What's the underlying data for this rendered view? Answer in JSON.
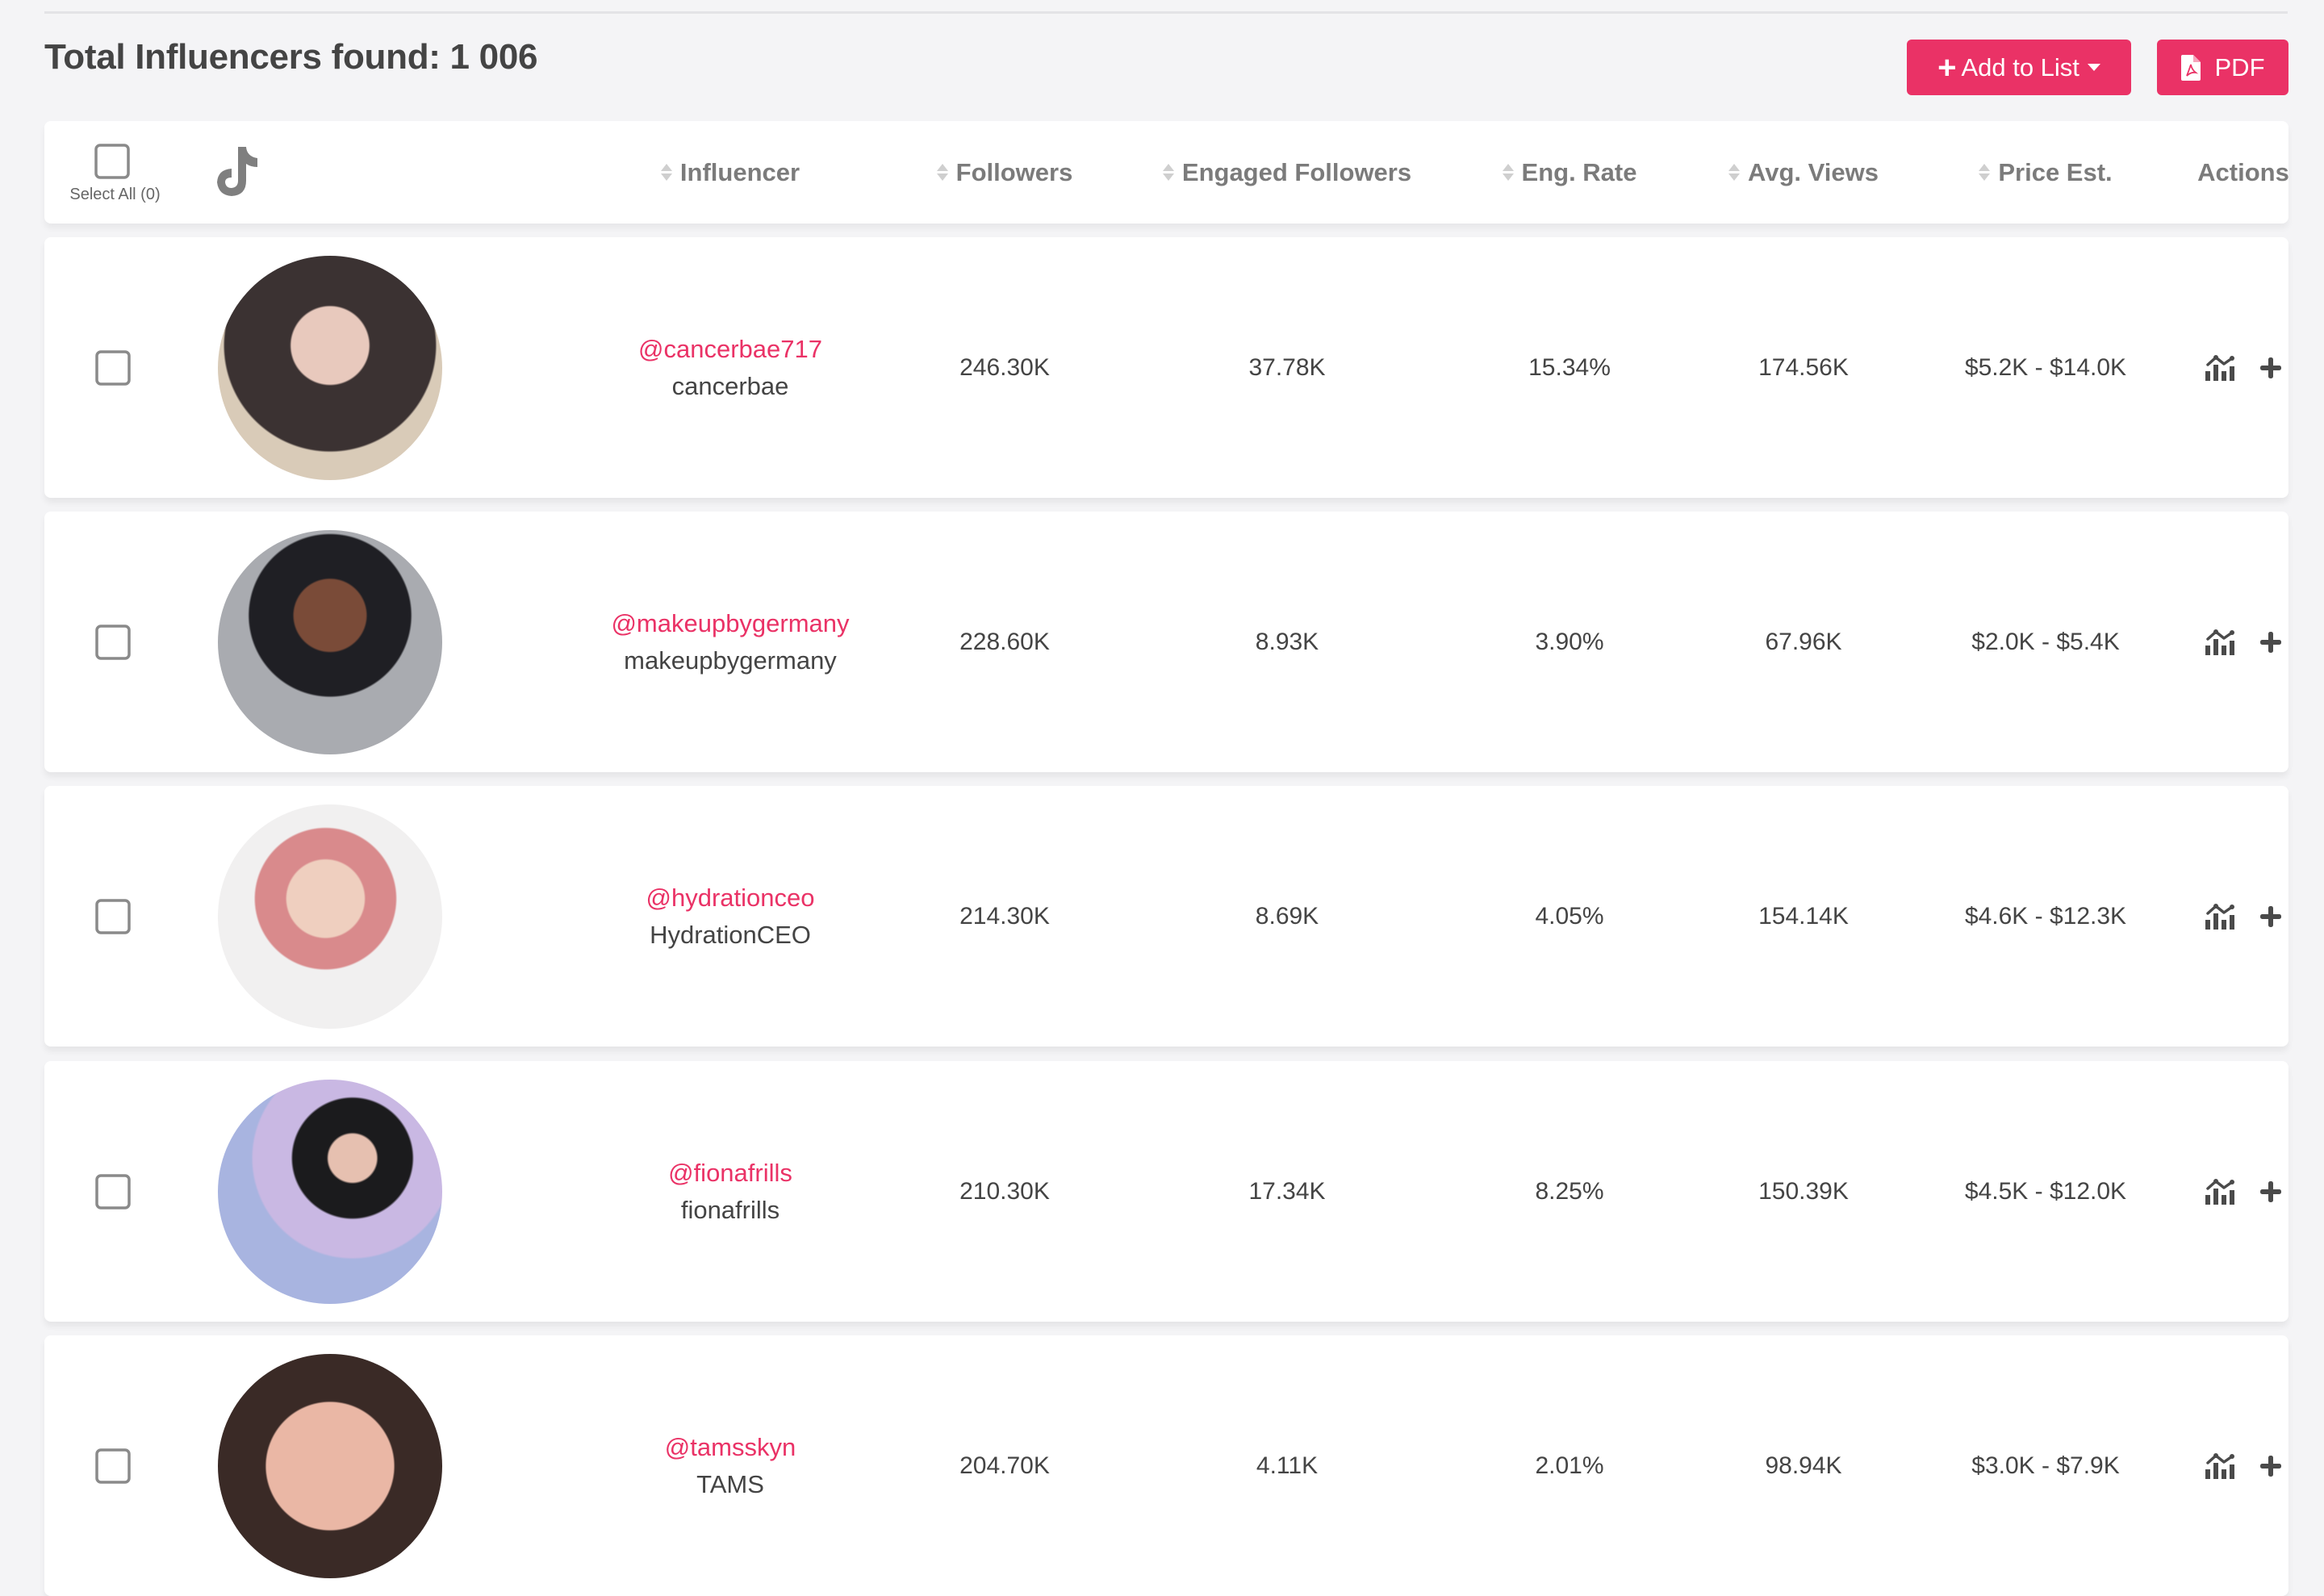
{
  "header": {
    "title": "Total Influencers found: 1 006",
    "add_to_list_label": "Add to List",
    "pdf_label": "PDF",
    "accent_color": "#ea3266"
  },
  "table": {
    "select_all_label": "Select All (0)",
    "platform_icon": "tiktok-icon",
    "columns": [
      {
        "label": "Influencer",
        "sortable": true
      },
      {
        "label": "Followers",
        "sortable": true
      },
      {
        "label": "Engaged Followers",
        "sortable": true
      },
      {
        "label": "Eng. Rate",
        "sortable": true
      },
      {
        "label": "Avg. Views",
        "sortable": true
      },
      {
        "label": "Price Est.",
        "sortable": true
      },
      {
        "label": "Actions",
        "sortable": false
      }
    ],
    "rows": [
      {
        "handle": "@cancerbae717",
        "name": "cancerbae",
        "followers": "246.30K",
        "engaged": "37.78K",
        "eng_rate": "15.34%",
        "avg_views": "174.56K",
        "price": "$5.2K - $14.0K",
        "checked": false
      },
      {
        "handle": "@makeupbygermany",
        "name": "makeupbygermany",
        "followers": "228.60K",
        "engaged": "8.93K",
        "eng_rate": "3.90%",
        "avg_views": "67.96K",
        "price": "$2.0K - $5.4K",
        "checked": false
      },
      {
        "handle": "@hydrationceo",
        "name": "HydrationCEO",
        "followers": "214.30K",
        "engaged": "8.69K",
        "eng_rate": "4.05%",
        "avg_views": "154.14K",
        "price": "$4.6K - $12.3K",
        "checked": false
      },
      {
        "handle": "@fionafrills",
        "name": "fionafrills",
        "followers": "210.30K",
        "engaged": "17.34K",
        "eng_rate": "8.25%",
        "avg_views": "150.39K",
        "price": "$4.5K - $12.0K",
        "checked": false
      },
      {
        "handle": "@tamsskyn",
        "name": "TAMS",
        "followers": "204.70K",
        "engaged": "4.11K",
        "eng_rate": "2.01%",
        "avg_views": "98.94K",
        "price": "$3.0K - $7.9K",
        "checked": false
      }
    ]
  }
}
